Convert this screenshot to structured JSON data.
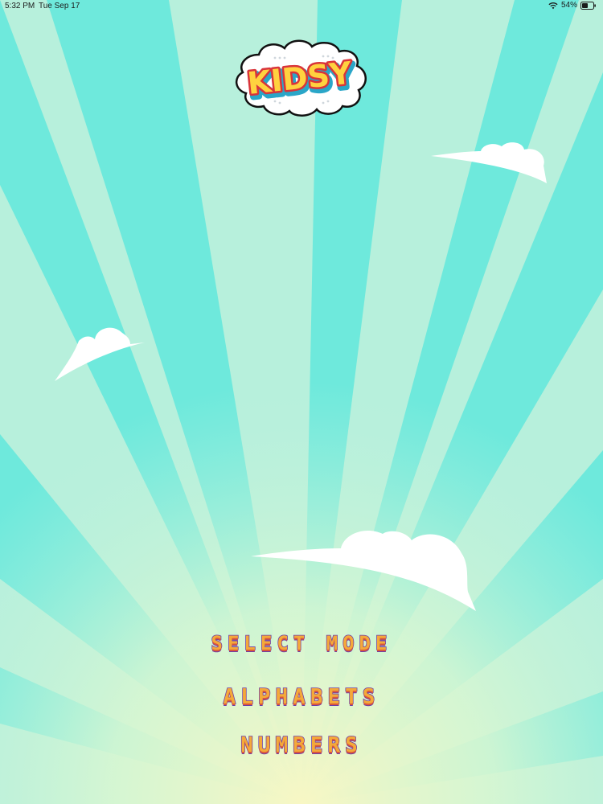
{
  "status_bar": {
    "time": "5:32 PM",
    "date": "Tue Sep 17",
    "battery": "54%",
    "battery_level": 0.54,
    "icons": [
      "wifi-icon",
      "battery-icon"
    ]
  },
  "logo": {
    "text": "KIDSY"
  },
  "menu": {
    "title": "SELECT MODE",
    "options": [
      "ALPHABETS",
      "NUMBERS"
    ]
  },
  "colors": {
    "sky_ray_light": "#b9f1dd",
    "sky_ray_dark": "#6ee9dc",
    "sun_glow": "#f7f7c6",
    "menu_fill": "#f4a93a",
    "menu_outline": "#6e3ea8",
    "menu_shadow": "#d9553c",
    "logo_fill": "#ffd23f",
    "logo_outline": "#d9343a",
    "logo_shadow": "#2aa6c8"
  }
}
